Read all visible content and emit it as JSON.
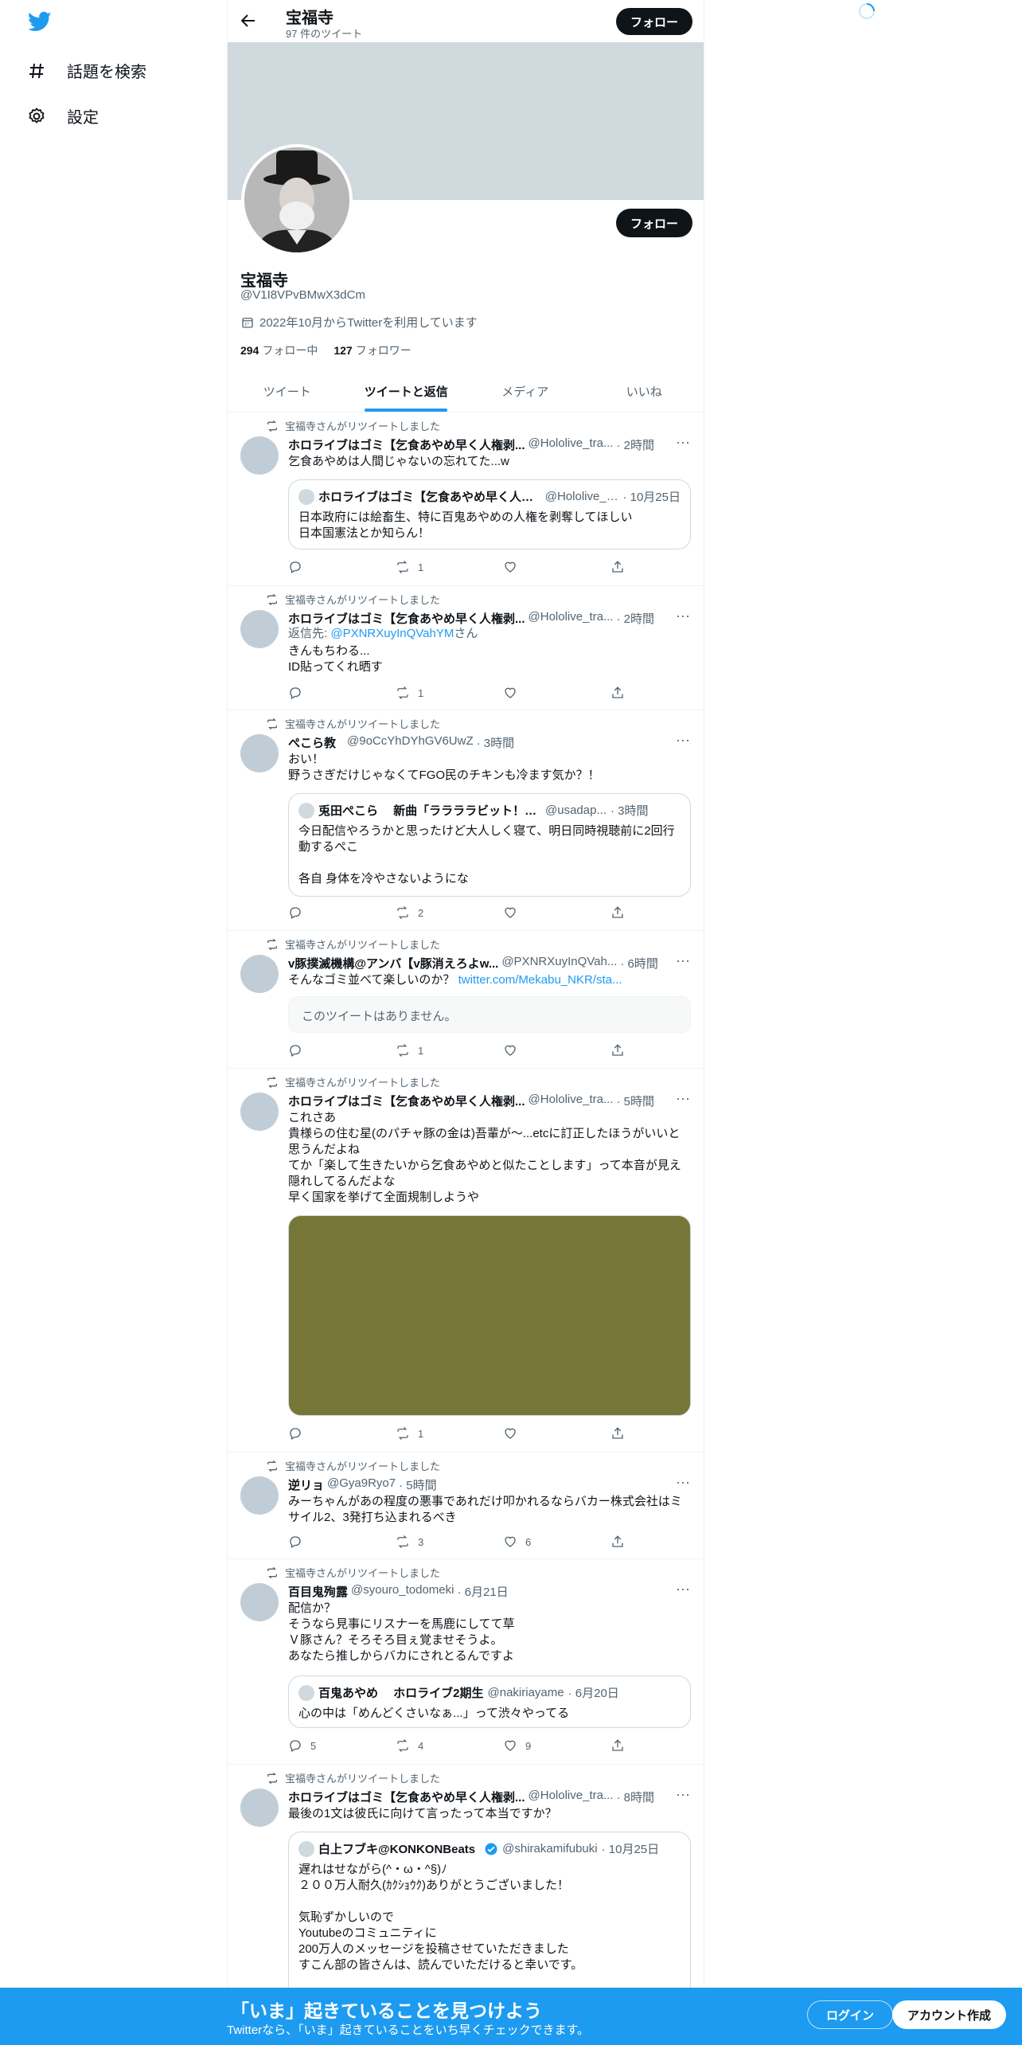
{
  "nav": {
    "explore_label": "話題を検索",
    "settings_label": "設定"
  },
  "profile": {
    "name": "宝福寺",
    "tweet_count": "97 件のツイート",
    "follow_label": "フォロー",
    "handle": "@V1I8VPvBMwX3dCm",
    "joined": "2022年10月からTwitterを利用しています",
    "following_count": "294",
    "following_label": "フォロー中",
    "followers_count": "127",
    "followers_label": "フォロワー"
  },
  "tabs": [
    {
      "label": "ツイート"
    },
    {
      "label": "ツイートと返信"
    },
    {
      "label": "メディア"
    },
    {
      "label": "いいね"
    }
  ],
  "retweet_label": "宝福寺さんがリツイートしました",
  "tweets": [
    {
      "name": "ホロライブはゴミ【乞食あやめ早く人権剥...",
      "handle": "@Hololive_tra...",
      "time": "· 2時間",
      "text": "乞食あやめは人間じゃないの忘れてた...w",
      "quote": {
        "name": "ホロライブはゴミ【乞食あやめ早く人権...",
        "handle": "@Hololive_t...",
        "time": "· 10月25日",
        "text": "日本政府には絵畜生、特に百鬼あやめの人権を剥奪してほしい\n日本国憲法とか知らん！"
      },
      "reply_count": "",
      "retweet_count": "1",
      "like_count": ""
    },
    {
      "name": "ホロライブはゴミ【乞食あやめ早く人権剥...",
      "handle": "@Hololive_tra...",
      "time": "· 2時間",
      "reply_prefix": "返信先: ",
      "reply_to": "@PXNRXuyInQVahYM",
      "reply_suffix": "さん",
      "text": "きんもちわる...\nID貼ってくれ晒す",
      "reply_count": "",
      "retweet_count": "1",
      "like_count": ""
    },
    {
      "name": "ぺこら教",
      "handle": "@9oCcYhDYhGV6UwZ",
      "time": "· 3時間",
      "text": "おい！\n野うさぎだけじゃなくてFGO民のチキンも冷ます気か？！",
      "quote": {
        "name": "兎田ぺこら　 新曲「ララララビット！！」歌っ...",
        "handle": "@usadap...",
        "time": "· 3時間",
        "text": "今日配信やろうかと思ったけど大人しく寝て、明日同時視聴前に2回行動するぺこ\n\n各自 身体を冷やさないようにな"
      },
      "reply_count": "",
      "retweet_count": "2",
      "like_count": ""
    },
    {
      "name": "v豚撲滅機構@アンバ【v豚消えろよw...",
      "handle": "@PXNRXuyInQVah...",
      "time": "· 6時間",
      "text": "そんなゴミ並べて楽しいのか？ ",
      "link": "twitter.com/Mekabu_NKR/sta...",
      "unavailable": "このツイートはありません。",
      "reply_count": "",
      "retweet_count": "1",
      "like_count": ""
    },
    {
      "name": "ホロライブはゴミ【乞食あやめ早く人権剥...",
      "handle": "@Hololive_tra...",
      "time": "· 5時間",
      "text": "これさあ\n貴様らの住む星(のパチャ豚の金は)吾輩が～...etcに訂正したほうがいいと思うんだよね\nてか「楽して生きたいから乞食あやめと似たことします」って本音が見え隠れしてるんだよな\n早く国家を挙げて全面規制しようや",
      "reply_count": "",
      "retweet_count": "1",
      "like_count": ""
    },
    {
      "name": "逆リョ",
      "handle": "@Gya9Ryo7",
      "time": "· 5時間",
      "text": "みーちゃんがあの程度の悪事であれだけ叩かれるならバカー株式会社はミサイル2、3発打ち込まれるべき",
      "reply_count": "",
      "retweet_count": "3",
      "like_count": "6"
    },
    {
      "name": "百目鬼殉露",
      "handle": "@syouro_todomeki",
      "time": "· 6月21日",
      "text": "配信か？\nそうなら見事にリスナーを馬鹿にしてて草\nＶ豚さん？そろそろ目ぇ覚ませそうよ。\nあなたら推しからバカにされとるんですよ",
      "quote": {
        "name": "百鬼あやめ　 ホロライブ2期生",
        "handle": "@nakiriayame",
        "time": "· 6月20日",
        "text": "心の中は「めんどくさいなぁ...」って渋々やってる"
      },
      "reply_count": "5",
      "retweet_count": "4",
      "like_count": "9"
    },
    {
      "name": "ホロライブはゴミ【乞食あやめ早く人権剥...",
      "handle": "@Hololive_tra...",
      "time": "· 8時間",
      "text": "最後の1文は彼氏に向けて言ったって本当ですか？",
      "quote": {
        "name": "白上フブキ@KONKONBeats",
        "handle": "@shirakamifubuki",
        "time": "· 10月25日",
        "text": "遅れはせながら(^・ω・^§)ﾉ\n２００万人耐久(ｶｸｼｮｳｸ)ありがとうございました！\n\n気恥ずかしいので\nYoutubeのコミュニティに\n200万人のメッセージを投稿させていただきました\nすこん部の皆さんは、読んでいただけると幸いです。"
      }
    }
  ],
  "bottom_bar": {
    "title": "「いま」起きていることを見つけよう",
    "subtitle": "Twitterなら、「いま」起きていることをいち早くチェックできます。",
    "login_label": "ログイン",
    "signup_label": "アカウント作成"
  },
  "colors": {
    "accent": "#1d9bf0",
    "dark": "#0f1419",
    "secondary_text": "#536471",
    "banner": "#cfd9de",
    "media_fill": "#757637"
  }
}
